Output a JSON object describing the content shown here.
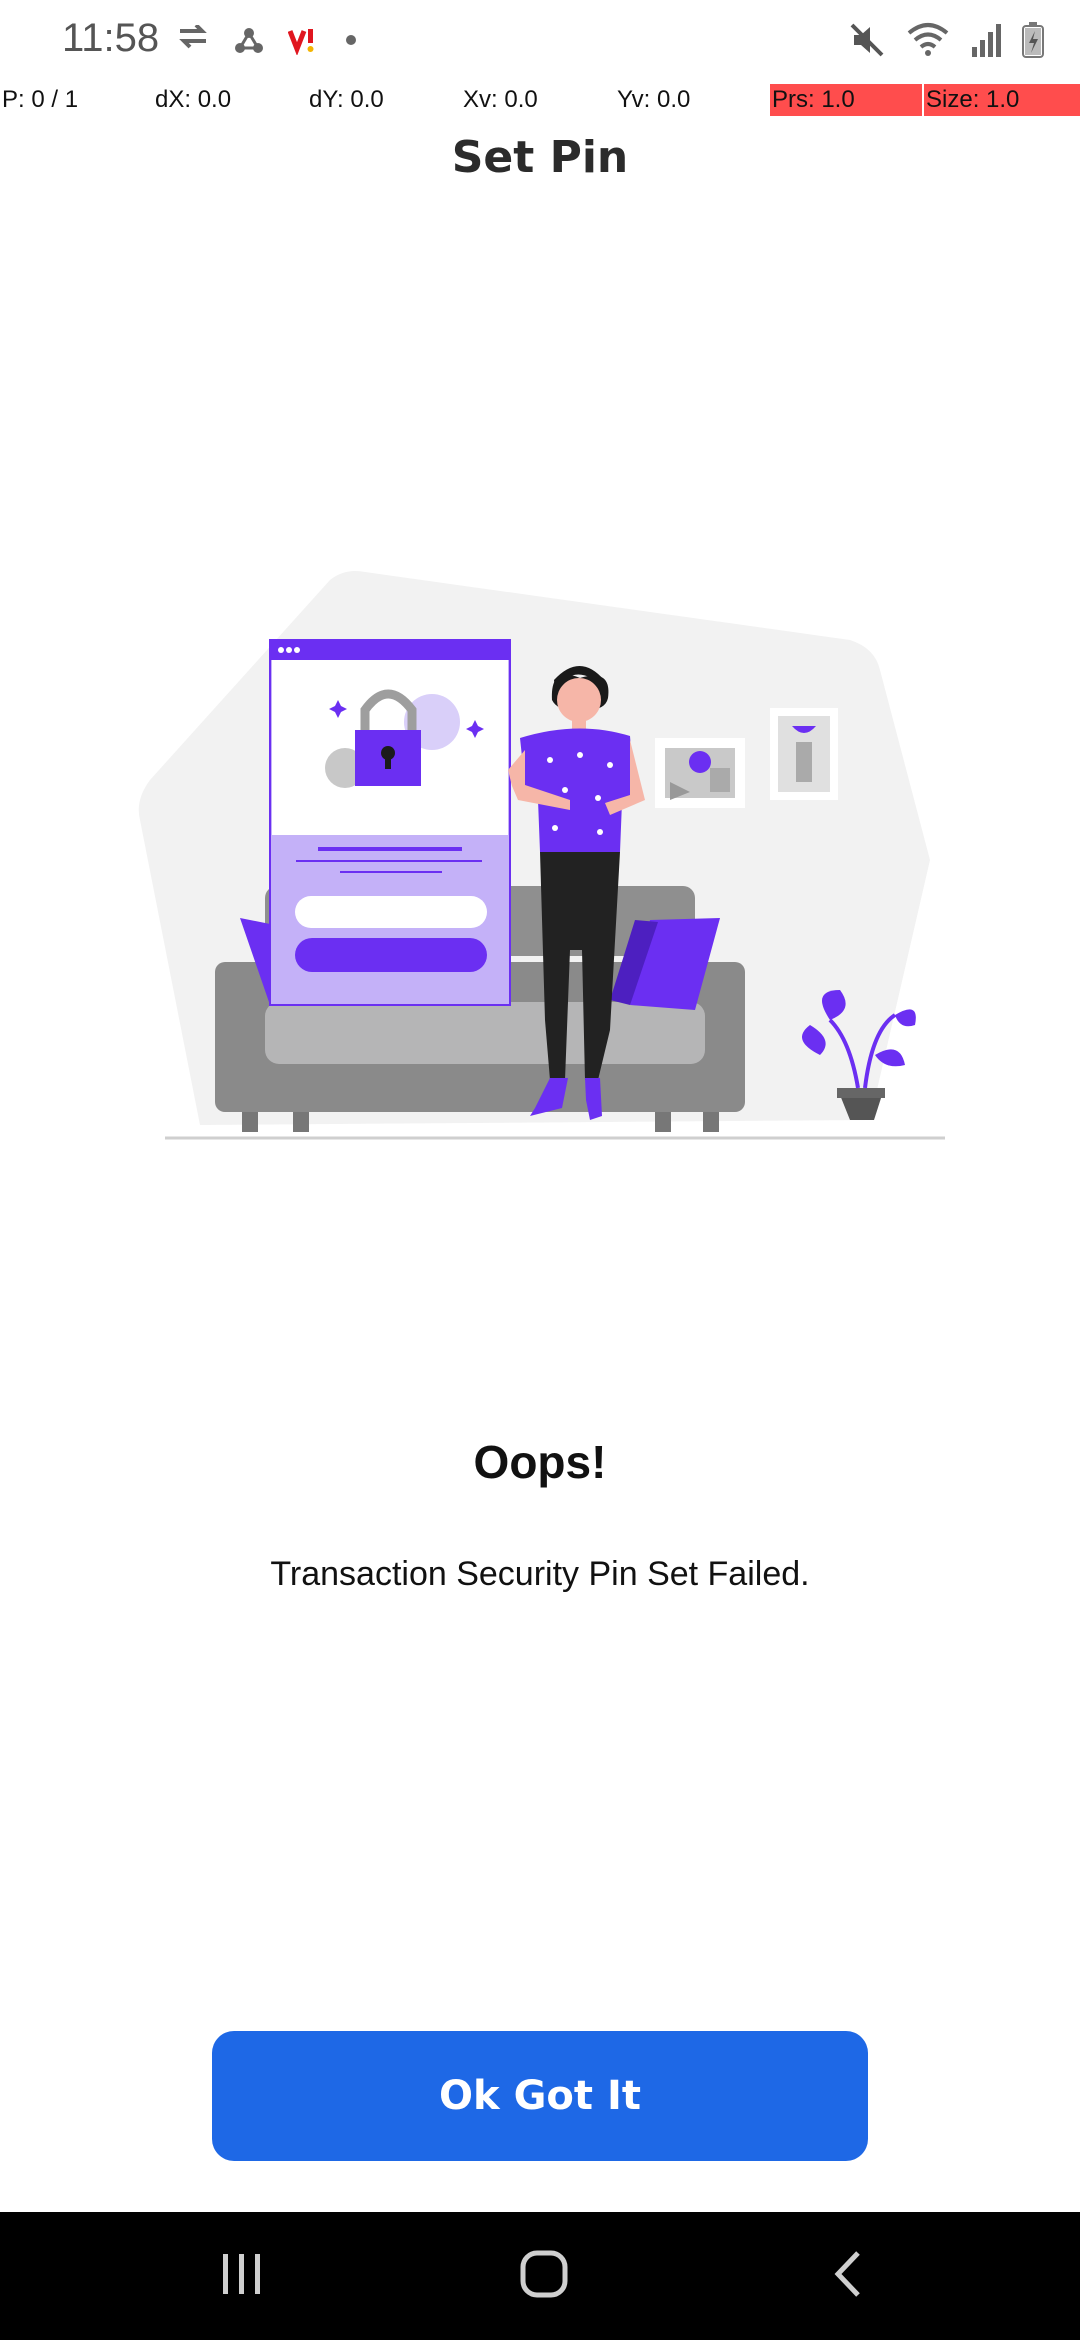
{
  "status_bar": {
    "time": "11:58",
    "left_icons": [
      "routing-icon",
      "hub-icon",
      "vi-carrier-icon",
      "dot-icon"
    ],
    "right_icons": [
      "mute-icon",
      "wifi-icon",
      "signal-icon",
      "battery-charging-icon"
    ]
  },
  "pointer_overlay": {
    "p": "P: 0 / 1",
    "dx": "dX: 0.0",
    "dy": "dY: 0.0",
    "xv": "Xv: 0.0",
    "yv": "Yv: 0.0",
    "prs": "Prs: 1.0",
    "size": "Size: 1.0",
    "highlight_color": "#ff4d4d"
  },
  "header": {
    "title": "Set Pin"
  },
  "result": {
    "heading": "Oops!",
    "message": "Transaction Security Pin Set Failed."
  },
  "actions": {
    "ok_label": "Ok Got It",
    "accent": "#1e68e6"
  },
  "illustration": {
    "accent": "#6b2ff2",
    "accent_light": "#c4b1f8"
  },
  "nav_bar": {
    "icons": [
      "recent-apps-icon",
      "home-icon",
      "back-icon"
    ]
  }
}
